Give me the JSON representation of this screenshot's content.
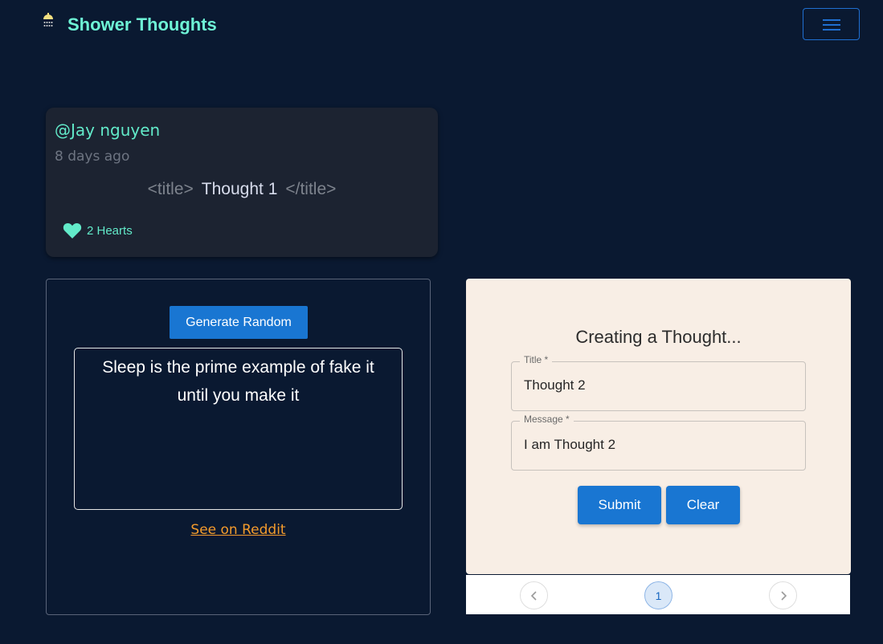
{
  "app": {
    "name": "Shower Thoughts"
  },
  "header": {
    "logo_icon": "shower-head-icon",
    "menu_icon": "hamburger-icon"
  },
  "post": {
    "author": "@Jay nguyen",
    "time": "8 days ago",
    "tag_open": "<title>",
    "title": "Thought 1",
    "tag_close": "</title>",
    "hearts_label": "2 Hearts",
    "heart_icon": "heart-icon"
  },
  "random": {
    "button_label": "Generate Random",
    "thought_text": "Sleep is the prime example of fake it until you make it",
    "link_label": "See on Reddit"
  },
  "form": {
    "heading": "Creating a Thought...",
    "title_label": "Title *",
    "title_value": "Thought 2",
    "message_label": "Message *",
    "message_value": "I am Thought 2",
    "submit_label": "Submit",
    "clear_label": "Clear"
  },
  "pagination": {
    "current_page": "1"
  },
  "colors": {
    "background": "#0a1931",
    "accent": "#62eac9",
    "primary": "#1976d2",
    "link": "#f39b2c",
    "form_bg": "#f8eee5"
  }
}
